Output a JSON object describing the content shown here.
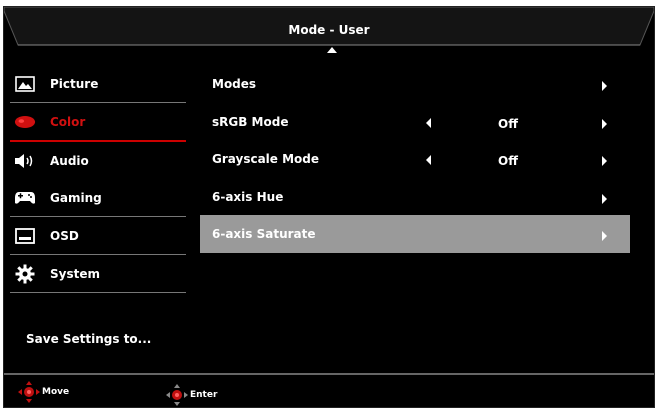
{
  "header": {
    "title": "Mode - User"
  },
  "sidebar": {
    "items": [
      {
        "label": "Picture",
        "icon": "picture-icon"
      },
      {
        "label": "Color",
        "icon": "color-icon",
        "active": true
      },
      {
        "label": "Audio",
        "icon": "speaker-icon"
      },
      {
        "label": "Gaming",
        "icon": "gamepad-icon"
      },
      {
        "label": "OSD",
        "icon": "osd-icon"
      },
      {
        "label": "System",
        "icon": "gear-icon"
      }
    ],
    "save_settings": "Save Settings to..."
  },
  "menu": {
    "rows": [
      {
        "label": "Modes",
        "value": ""
      },
      {
        "label": "sRGB Mode",
        "value": "Off"
      },
      {
        "label": "Grayscale Mode",
        "value": "Off"
      },
      {
        "label": "6-axis Hue",
        "value": ""
      },
      {
        "label": "6-axis Saturate",
        "value": "",
        "selected": true
      }
    ]
  },
  "footer": {
    "move_label": "Move",
    "enter_label": "Enter"
  },
  "colors": {
    "accent": "#cc0000",
    "selected_row": "#9a9a9a",
    "background": "#000000"
  }
}
